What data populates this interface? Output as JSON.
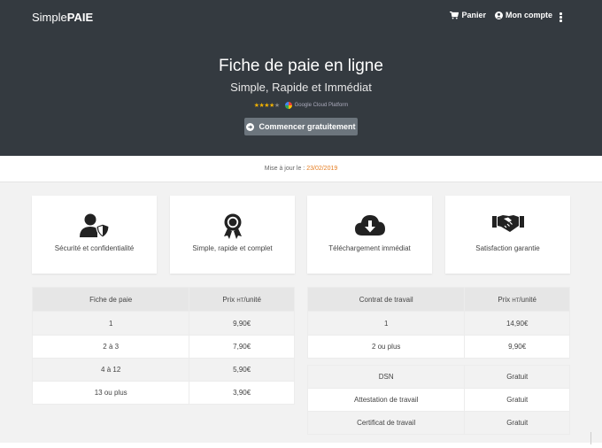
{
  "brand": {
    "prefix": "Simple",
    "bold": "PAIE"
  },
  "nav": {
    "cart": "Panier",
    "account": "Mon compte"
  },
  "hero": {
    "title": "Fiche de paie en ligne",
    "subtitle": "Simple, Rapide et Immédiat",
    "partner": "Google Cloud Platform",
    "cta": "Commencer gratuitement"
  },
  "update": {
    "label": "Mise à jour le :",
    "date": "23/02/2019"
  },
  "features": [
    {
      "label": "Sécurité et confidentialité",
      "icon": "user-shield-icon"
    },
    {
      "label": "Simple, rapide et complet",
      "icon": "award-ribbon-icon"
    },
    {
      "label": "Téléchargement immédiat",
      "icon": "cloud-download-icon"
    },
    {
      "label": "Satisfaction garantie",
      "icon": "handshake-icon"
    }
  ],
  "payslip_table": {
    "headers": [
      "Fiche de paie",
      "Prix",
      "HT",
      "/unité"
    ],
    "rows": [
      [
        "1",
        "9,90€"
      ],
      [
        "2 à 3",
        "7,90€"
      ],
      [
        "4 à 12",
        "5,90€"
      ],
      [
        "13 ou plus",
        "3,90€"
      ]
    ]
  },
  "contract_table": {
    "headers": [
      "Contrat de travail",
      "Prix",
      "HT",
      "/unité"
    ],
    "rows": [
      [
        "1",
        "14,90€"
      ],
      [
        "2 ou plus",
        "9,90€"
      ]
    ]
  },
  "extras_table": {
    "rows": [
      [
        "DSN",
        "Gratuit"
      ],
      [
        "Attestation de travail",
        "Gratuit"
      ],
      [
        "Certificat de travail",
        "Gratuit"
      ]
    ]
  },
  "colors": {
    "header": "#343a40",
    "cta": "#6c757d",
    "date": "#e67e22",
    "stars": "#f0b000"
  }
}
